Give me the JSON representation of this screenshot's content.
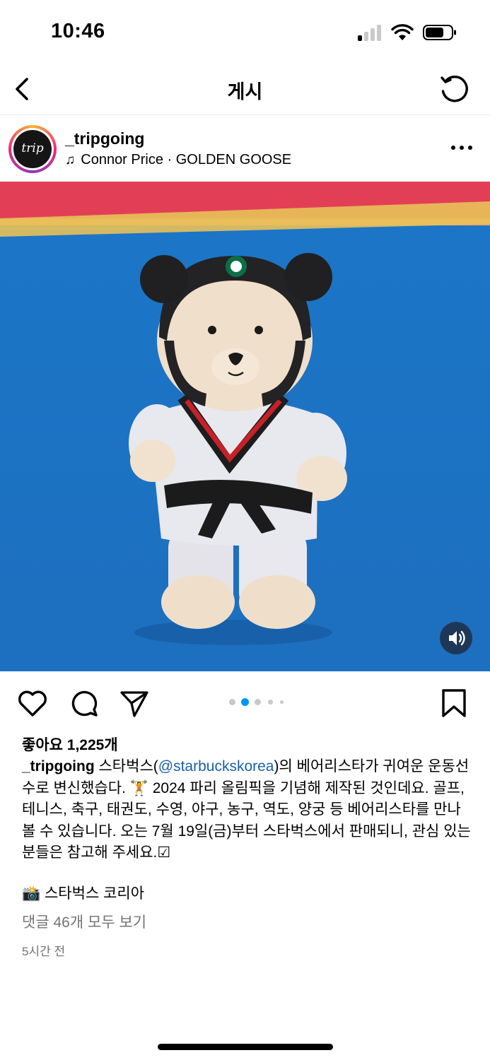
{
  "status_bar": {
    "time": "10:46"
  },
  "nav": {
    "title": "게시"
  },
  "post": {
    "username": "_tripgoing",
    "avatar_text": "trip",
    "music": "Connor Price · GOLDEN GOOSE",
    "carousel": {
      "count": 5,
      "active_index": 1
    },
    "likes": "좋아요 1,225개",
    "caption": {
      "user": "_tripgoing",
      "part1": " 스타벅스(",
      "mention": "@starbuckskorea",
      "part2": ")의 베어리스타가 귀여운 운동선수로 변신했습다. 🏋 2024 파리 올림픽을 기념해 제작된 것인데요. 골프, 테니스, 축구, 태권도, 수영, 야구, 농구, 역도, 양궁 등 베어리스타를 만나 볼 수 있습니다. 오는 7월 19일(금)부터 스타벅스에서 판매되니, 관심 있는 분들은 참고해 주세요.☑"
    },
    "fact_line": "📸 스타벅스 코리아",
    "comments_link": "댓글 46개 모두 보기",
    "timestamp": "5시간 전"
  },
  "icons": {
    "back": "chevron-left-icon",
    "refresh": "refresh-icon",
    "more": "more-icon",
    "like": "heart-icon",
    "comment": "comment-icon",
    "share": "send-icon",
    "save": "bookmark-icon",
    "sound": "speaker-icon"
  },
  "colors": {
    "mention": "#1a5fa8",
    "carousel_active": "#0095f6",
    "muted_text": "#737373"
  }
}
